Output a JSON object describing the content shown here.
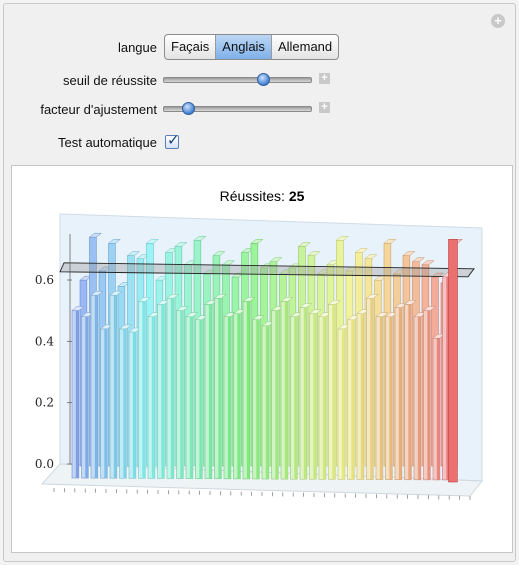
{
  "controls": {
    "langue": {
      "label": "langue",
      "options": [
        "Façais",
        "Anglais",
        "Allemand"
      ],
      "selected": "Anglais"
    },
    "seuil": {
      "label": "seuil de réussite",
      "value": 0.68
    },
    "facteur": {
      "label": "facteur d'ajustement",
      "value": 0.17
    },
    "test": {
      "label": "Test automatique",
      "checked": true
    }
  },
  "plot": {
    "title_prefix": "Réussites:",
    "title_value": "25",
    "chart_data": {
      "type": "bar",
      "y_ticks": [
        "0.0",
        "0.2",
        "0.4",
        "0.6"
      ],
      "ylim": [
        0,
        0.75
      ],
      "threshold": 0.63,
      "values": [
        0.58,
        0.72,
        0.61,
        0.7,
        0.56,
        0.66,
        0.65,
        0.7,
        0.58,
        0.67,
        0.69,
        0.63,
        0.71,
        0.6,
        0.66,
        0.63,
        0.59,
        0.67,
        0.7,
        0.62,
        0.64,
        0.6,
        0.62,
        0.69,
        0.66,
        0.6,
        0.63,
        0.71,
        0.61,
        0.67,
        0.65,
        0.58,
        0.7,
        0.6,
        0.66,
        0.64,
        0.63,
        0.59,
        0.57,
        0.7
      ],
      "front_values": [
        0.52,
        0.5,
        0.57,
        0.46,
        0.57,
        0.46,
        0.45,
        0.55,
        0.5,
        0.54,
        0.56,
        0.52,
        0.5,
        0.49,
        0.54,
        0.56,
        0.5,
        0.51,
        0.55,
        0.49,
        0.47,
        0.52,
        0.55,
        0.5,
        0.53,
        0.51,
        0.5,
        0.54,
        0.46,
        0.49,
        0.51,
        0.56,
        0.5,
        0.5,
        0.53,
        0.54,
        0.5,
        0.52,
        0.43,
        0.63
      ]
    }
  }
}
